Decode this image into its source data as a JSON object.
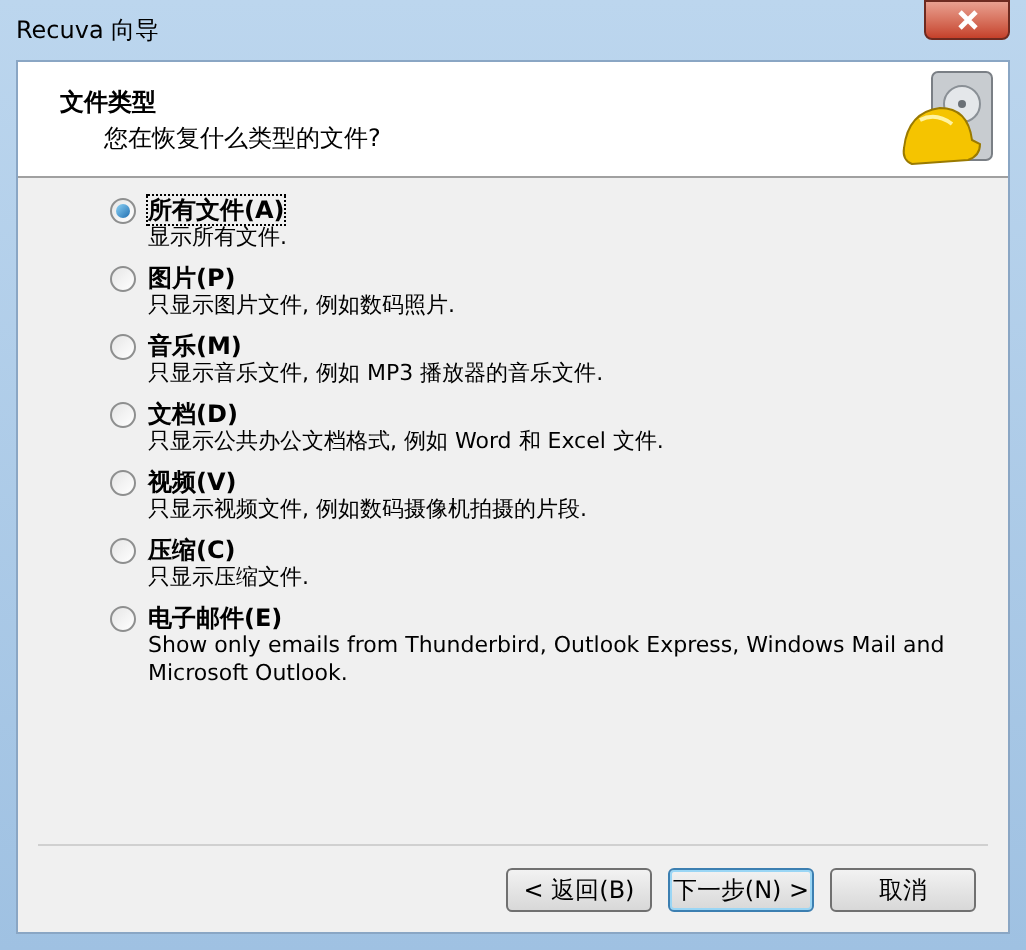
{
  "window": {
    "title": "Recuva 向导"
  },
  "header": {
    "title": "文件类型",
    "subtitle": "您在恢复什么类型的文件?"
  },
  "options": [
    {
      "label": "所有文件(A)",
      "description": "显示所有文件.",
      "selected": true
    },
    {
      "label": "图片(P)",
      "description": "只显示图片文件, 例如数码照片.",
      "selected": false
    },
    {
      "label": "音乐(M)",
      "description": "只显示音乐文件, 例如 MP3 播放器的音乐文件.",
      "selected": false
    },
    {
      "label": "文档(D)",
      "description": "只显示公共办公文档格式, 例如 Word 和 Excel 文件.",
      "selected": false
    },
    {
      "label": "视频(V)",
      "description": "只显示视频文件, 例如数码摄像机拍摄的片段.",
      "selected": false
    },
    {
      "label": "压缩(C)",
      "description": "只显示压缩文件.",
      "selected": false
    },
    {
      "label": "电子邮件(E)",
      "description": "Show only emails from Thunderbird, Outlook Express, Windows Mail and Microsoft Outlook.",
      "selected": false
    }
  ],
  "buttons": [
    {
      "label": "< 返回(B)",
      "default": false
    },
    {
      "label": "下一步(N) >",
      "default": true
    },
    {
      "label": "取消",
      "default": false
    }
  ]
}
